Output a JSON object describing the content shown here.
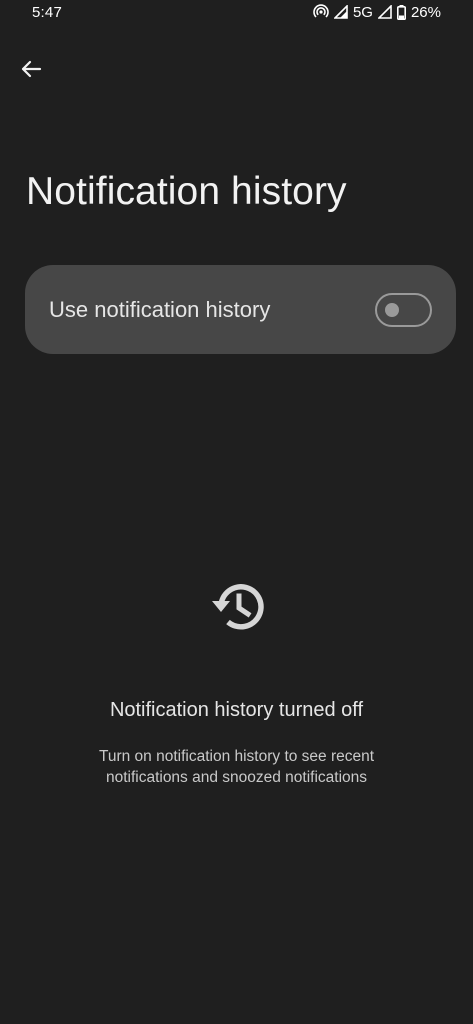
{
  "status_bar": {
    "time": "5:47",
    "network": "5G",
    "battery": "26%",
    "icons": [
      "hotspot-icon",
      "signal-icon",
      "signal-icon",
      "battery-icon"
    ]
  },
  "header": {
    "back_icon": "arrow-left-icon",
    "title": "Notification history"
  },
  "setting": {
    "label": "Use notification history",
    "enabled": false
  },
  "empty_state": {
    "icon": "history-icon",
    "title": "Notification history turned off",
    "description": "Turn on notification history to see recent notifications and snoozed notifications"
  },
  "colors": {
    "background": "#1f1f1f",
    "card": "#474747",
    "switch_outline": "#9a9a9a"
  }
}
